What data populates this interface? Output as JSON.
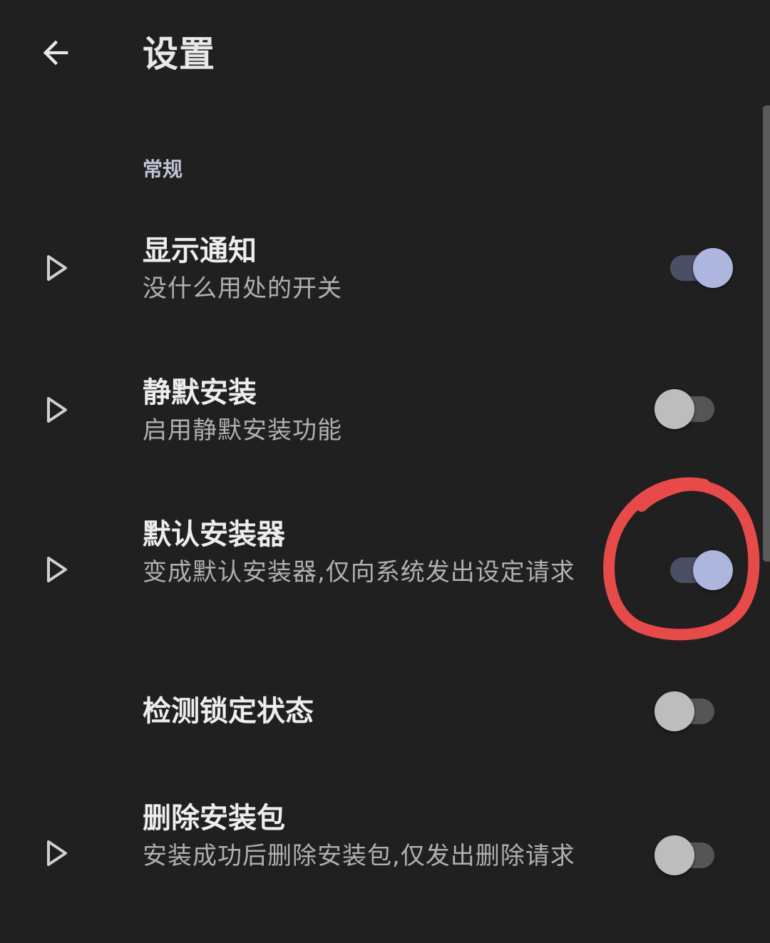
{
  "app_bar": {
    "title": "设置",
    "back_icon": "arrow-back-icon"
  },
  "section": {
    "header": "常规"
  },
  "preferences": [
    {
      "title": "显示通知",
      "summary": "没什么用处的开关",
      "expandable": true,
      "enabled": true
    },
    {
      "title": "静默安装",
      "summary": "启用静默安装功能",
      "expandable": true,
      "enabled": false
    },
    {
      "title": "默认安装器",
      "summary": "变成默认安装器,仅向系统发出设定请求",
      "expandable": true,
      "enabled": true
    },
    {
      "title": "检测锁定状态",
      "summary": "",
      "expandable": false,
      "enabled": false
    },
    {
      "title": "删除安装包",
      "summary": "安装成功后删除安装包,仅发出删除请求",
      "expandable": true,
      "enabled": false
    }
  ],
  "colors": {
    "background": "#202020",
    "switch_on_thumb": "#aeb6e0",
    "switch_on_track": "#4b4f66",
    "switch_off_thumb": "#bdbdbd",
    "switch_off_track": "#555555",
    "annotation": "#e84a4a"
  }
}
